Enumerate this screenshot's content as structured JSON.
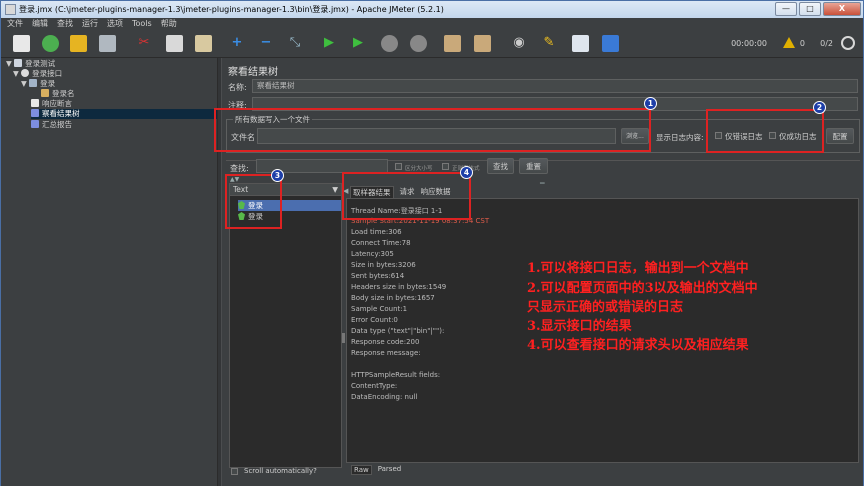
{
  "window": {
    "title": "登录.jmx (C:\\jmeter-plugins-manager-1.3\\jmeter-plugins-manager-1.3\\bin\\登录.jmx) - Apache JMeter (5.2.1)",
    "minimize_label": "—",
    "maximize_label": "□",
    "close_label": "X"
  },
  "menu": [
    "文件",
    "编辑",
    "查找",
    "运行",
    "选项",
    "Tools",
    "帮助"
  ],
  "toolbar": {
    "timer": "00:00:00",
    "warning_count": "0",
    "threads": "0/2"
  },
  "tree": {
    "items": [
      {
        "label": "登录测试",
        "icon": "testplan-icon"
      },
      {
        "label": "登录接口",
        "icon": "gear-icon"
      },
      {
        "label": "登录",
        "icon": "pencil-icon"
      },
      {
        "label": "登录名",
        "icon": "tool-icon"
      },
      {
        "label": "响应断言",
        "icon": "doc-icon"
      },
      {
        "label": "察看结果树",
        "icon": "chart-icon"
      },
      {
        "label": "汇总报告",
        "icon": "chart-icon"
      }
    ]
  },
  "main": {
    "heading": "察看结果树",
    "name_label": "名称:",
    "name_value": "察看结果树",
    "comment_label": "注释:",
    "comment_value": "",
    "file_group_legend": "所有数据写入一个文件",
    "filename_label": "文件名",
    "filename_value": "",
    "browse_button": "浏览...",
    "log_content_label": "显示日志内容:",
    "errors_only_label": "仅错误日志",
    "success_only_label": "仅成功日志",
    "configure_button": "配置",
    "search_label": "查找:",
    "search_value": "",
    "case_sensitive_label": "区分大小写",
    "regex_label": "正则表达式",
    "search_button": "查找",
    "reset_button": "重置",
    "renderer_label": "Text",
    "results": [
      "登录",
      "登录"
    ],
    "scroll_auto_label": "Scroll automatically?",
    "tabs": [
      "取样器结果",
      "请求",
      "响应数据"
    ],
    "result_lines": [
      "Thread Name:登录接口 1-1",
      "Sample Start:2021-11-19 08:37:54 CST",
      "Load time:306",
      "Connect Time:78",
      "Latency:305",
      "Size in bytes:3206",
      "Sent bytes:614",
      "Headers size in bytes:1549",
      "Body size in bytes:1657",
      "Sample Count:1",
      "Error Count:0",
      "Data type (\"text\"|\"bin\"|\"\"):",
      "Response code:200",
      "Response message:",
      "",
      "HTTPSampleResult fields:",
      "ContentType:",
      "DataEncoding: null"
    ],
    "bottom_tabs": [
      "Raw",
      "Parsed"
    ]
  },
  "annotations": {
    "badges": [
      "1",
      "2",
      "3",
      "4"
    ],
    "notes": [
      "1.可以将接口日志，输出到一个文档中",
      "2.可以配置页面中的3以及输出的文档中",
      "只显示正确的或错误的日志",
      "3.显示接口的结果",
      "4.可以查看接口的请求头以及相应结果"
    ],
    "color": "#ff2020"
  }
}
